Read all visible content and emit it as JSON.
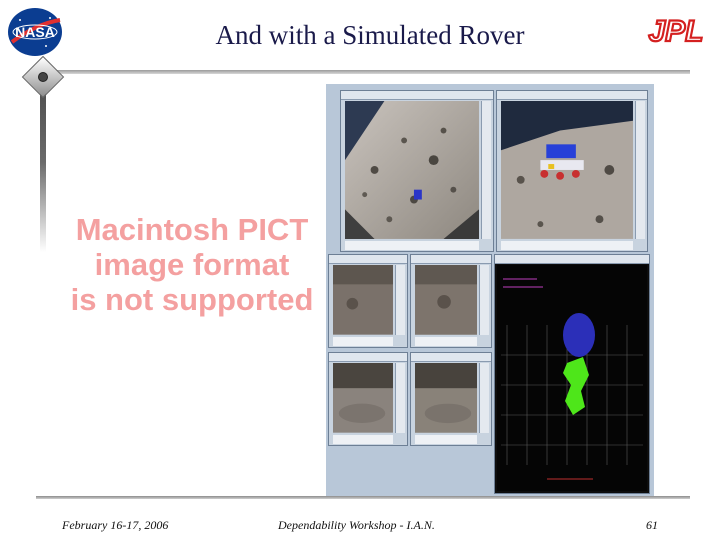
{
  "slide": {
    "title": "And with a Simulated Rover",
    "pict_placeholder": [
      "Macintosh PICT",
      "image format",
      "is not supported"
    ]
  },
  "logos": {
    "nasa": "NASA",
    "jpl": "JPL"
  },
  "footer": {
    "date": "February 16-17, 2006",
    "center": "Dependability Workshop - I.A.N.",
    "page": "61"
  },
  "colors": {
    "title": "#1a1a4a",
    "pict_text": "#f4a0a0",
    "jpl_red": "#d42020",
    "nasa_blue": "#0b3d91"
  }
}
